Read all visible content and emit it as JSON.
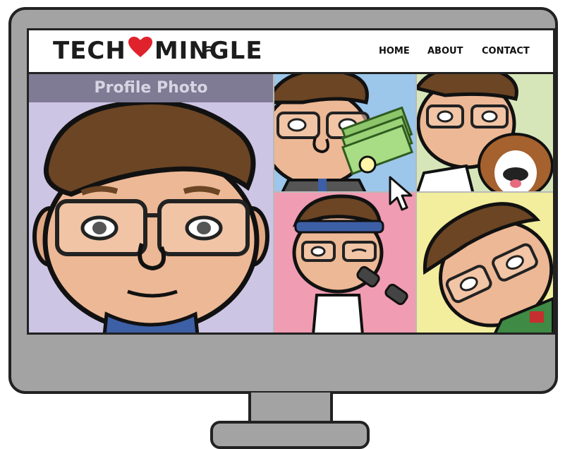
{
  "site": {
    "logo_left": "TECH",
    "logo_right": "MINGLE",
    "brand_heart_color": "#e0222c"
  },
  "nav": {
    "items": [
      "HOME",
      "ABOUT",
      "CONTACT"
    ]
  },
  "profile": {
    "label": "Profile Photo"
  },
  "tiles": {
    "main": {
      "bg": "#cdc5e4"
    },
    "money": {
      "bg": "#9cc6ea"
    },
    "dog": {
      "bg": "#d6e6b9"
    },
    "gym": {
      "bg": "#f09cb2"
    },
    "tilt": {
      "bg": "#f3ee9d"
    }
  },
  "icons": [
    "heart-icon",
    "wifi-icon",
    "mouse-cursor-icon"
  ]
}
